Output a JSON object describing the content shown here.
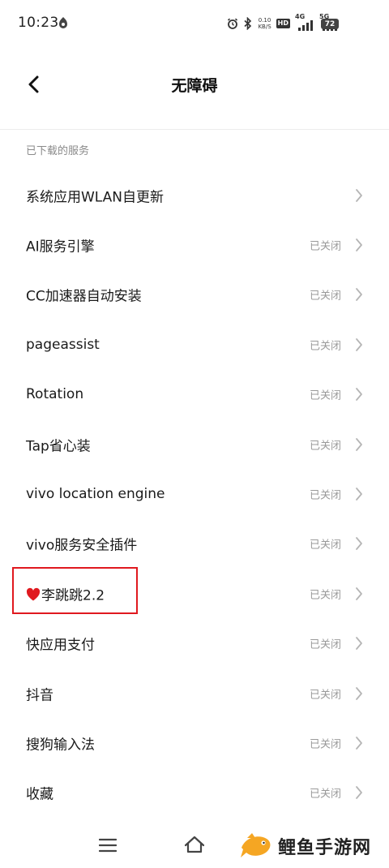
{
  "status_bar": {
    "time": "10:23",
    "net_speed_value": "0.10",
    "net_speed_unit": "KB/S",
    "hd_label": "HD",
    "signal1_label": "4G",
    "signal2_label": "5G",
    "battery_level": "72"
  },
  "header": {
    "title": "无障碍"
  },
  "section": {
    "label": "已下载的服务"
  },
  "services": [
    {
      "name": "系统应用WLAN自更新",
      "status": ""
    },
    {
      "name": "AI服务引擎",
      "status": "已关闭"
    },
    {
      "name": "CC加速器自动安装",
      "status": "已关闭"
    },
    {
      "name": "pageassist",
      "status": "已关闭"
    },
    {
      "name": "Rotation",
      "status": "已关闭"
    },
    {
      "name": "Tap省心装",
      "status": "已关闭"
    },
    {
      "name": "vivo location engine",
      "status": "已关闭"
    },
    {
      "name": "vivo服务安全插件",
      "status": "已关闭"
    },
    {
      "name": "李跳跳2.2",
      "status": "已关闭",
      "icon": "heart-icon"
    },
    {
      "name": "快应用支付",
      "status": "已关闭"
    },
    {
      "name": "抖音",
      "status": "已关闭"
    },
    {
      "name": "搜狗输入法",
      "status": "已关闭"
    },
    {
      "name": "收藏",
      "status": "已关闭"
    }
  ],
  "watermark": {
    "text": "鲤鱼手游网"
  },
  "colors": {
    "highlight_border": "#e0191f",
    "heart": "#e0191f",
    "status_text": "#9a9a9a",
    "watermark_fish": "#f5a623"
  }
}
